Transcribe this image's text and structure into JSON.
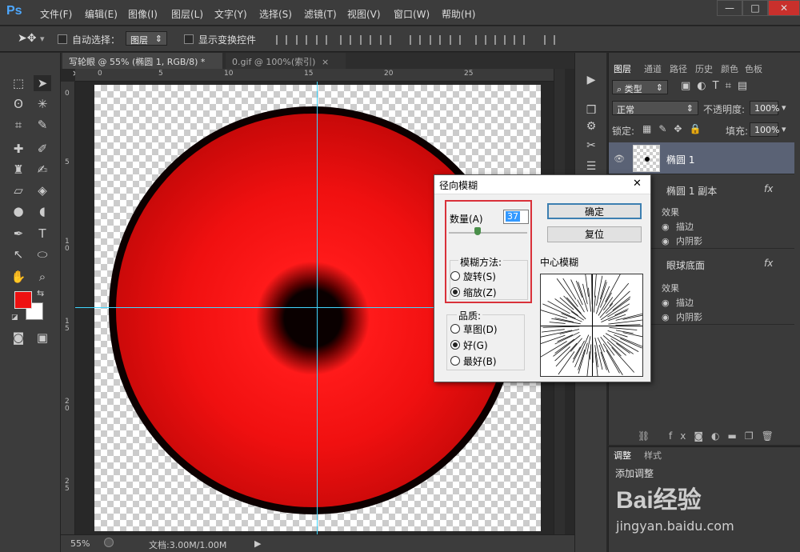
{
  "app": {
    "logo": "Ps"
  },
  "menu": [
    "文件(F)",
    "编辑(E)",
    "图像(I)",
    "图层(L)",
    "文字(Y)",
    "选择(S)",
    "滤镜(T)",
    "视图(V)",
    "窗口(W)",
    "帮助(H)"
  ],
  "window_controls": {
    "minimize": "—",
    "restore": "□",
    "close": "✕"
  },
  "options": {
    "auto_select_label": "自动选择：",
    "auto_select_value": "图层",
    "show_transform_label": "显示变换控件"
  },
  "tabs": [
    {
      "label": "写轮眼 @ 55% (椭圆 1, RGB/8) *",
      "close": "×",
      "active": true
    },
    {
      "label": "0.gif @ 100%(索引)",
      "close": "×",
      "active": false
    }
  ],
  "rulers": {
    "h_ticks": [
      "0",
      "5",
      "10",
      "15",
      "20",
      "25"
    ],
    "v_ticks": [
      "0",
      "5",
      "1\n0",
      "1\n5",
      "2\n0",
      "2\n5"
    ]
  },
  "status": {
    "zoom": "55%",
    "doc": "文档:3.00M/1.00M",
    "arrow": "▶"
  },
  "layers_panel": {
    "tabs": [
      "图层",
      "通道",
      "路径",
      "历史",
      "颜色",
      "色板"
    ],
    "filter_kind": "类型",
    "blend_mode": "正常",
    "opacity_label": "不透明度:",
    "opacity_value": "100%",
    "lock_label": "锁定:",
    "fill_label": "填充:",
    "fill_value": "100%",
    "layers": [
      {
        "name": "椭圆 1",
        "selected": true
      },
      {
        "name": "椭圆 1 副本",
        "fx": "fx",
        "effects_label": "效果",
        "effects": [
          "描边",
          "内阴影"
        ]
      },
      {
        "name": "眼球底面",
        "fx": "fx",
        "effects_label": "效果",
        "effects": [
          "描边",
          "内阴影"
        ]
      }
    ]
  },
  "adjust_panel": {
    "tabs": [
      "调整",
      "样式"
    ],
    "add_label": "添加调整"
  },
  "dialog": {
    "title": "径向模糊",
    "close": "✕",
    "amount_label": "数量(A)",
    "amount_value": "37",
    "amount_fraction": 0.37,
    "ok": "确定",
    "reset": "复位",
    "method_label": "模糊方法:",
    "methods": [
      {
        "label": "旋转(S)",
        "checked": false
      },
      {
        "label": "缩放(Z)",
        "checked": true
      }
    ],
    "quality_label": "品质:",
    "qualities": [
      {
        "label": "草图(D)",
        "checked": false
      },
      {
        "label": "好(G)",
        "checked": true
      },
      {
        "label": "最好(B)",
        "checked": false
      }
    ],
    "center_label": "中心模糊"
  },
  "watermark": {
    "brand": "Bai经验",
    "url": "jingyan.baidu.com"
  },
  "colors": {
    "foreground": "#ee1111",
    "background": "#ffffff",
    "annotation": "#d9313a",
    "guide": "#3fd7ff"
  }
}
